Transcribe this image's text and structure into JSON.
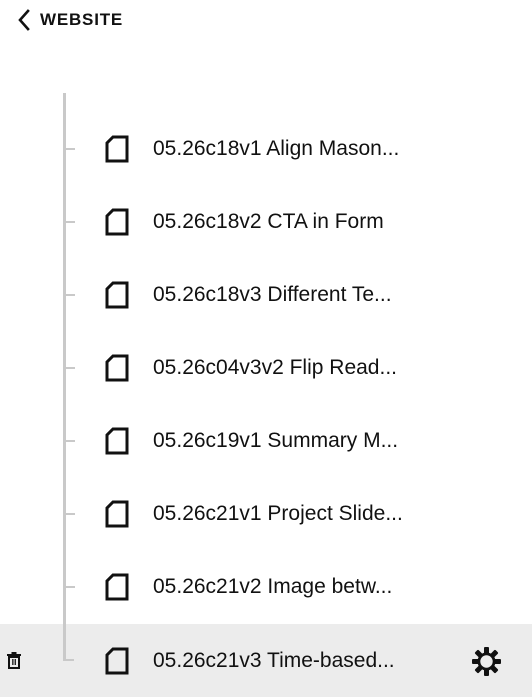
{
  "header": {
    "back_label": "WEBSITE"
  },
  "pages": [
    {
      "title": "05.26c18v1 Align Mason..."
    },
    {
      "title": "05.26c18v2 CTA in Form"
    },
    {
      "title": "05.26c18v3 Different Te..."
    },
    {
      "title": "05.26c04v3v2 Flip Read..."
    },
    {
      "title": "05.26c19v1 Summary M..."
    },
    {
      "title": "05.26c21v1 Project Slide..."
    },
    {
      "title": "05.26c21v2 Image betw..."
    },
    {
      "title": "05.26c21v3 Time-based...",
      "selected": true
    }
  ],
  "icons": {
    "back": "chevron-left-icon",
    "page": "page-icon",
    "delete": "trash-icon",
    "settings": "gear-icon"
  },
  "colors": {
    "selected_row_bg": "#ececec",
    "tree_line": "#c9c9c9",
    "text": "#111111"
  }
}
